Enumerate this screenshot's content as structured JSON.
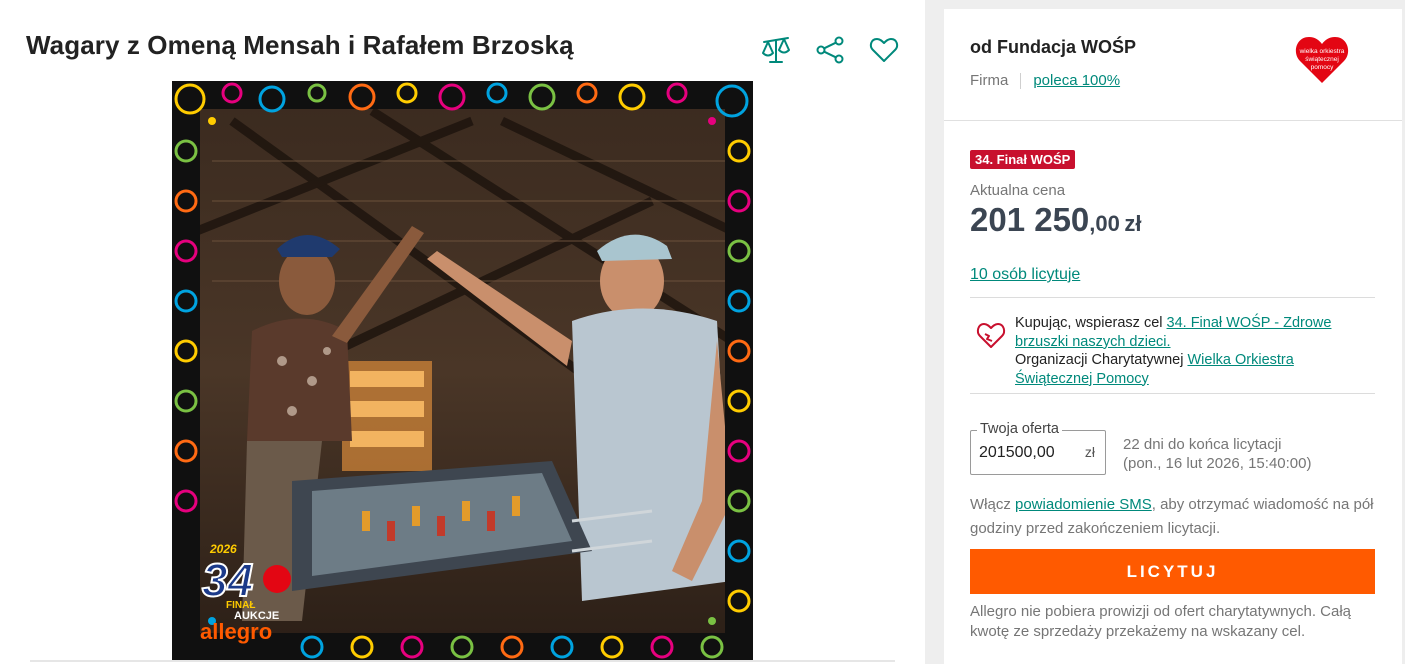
{
  "offer": {
    "title": "Wagary z Omeną Mensah i Rafałem Brzoską",
    "actions": [
      {
        "icon": "compare-scales-icon"
      },
      {
        "icon": "share-icon"
      },
      {
        "icon": "heart-icon"
      }
    ],
    "image": {
      "frame_text": "allegro",
      "event_label": "34",
      "year": "2026",
      "finale_label": "FINAŁ",
      "aukcje_label": "AUKCJE"
    }
  },
  "seller": {
    "name": "od Fundacja WOŚP",
    "type": "Firma",
    "recommend": "poleca 100%",
    "logo_text": [
      "wielka orkiestra",
      "świątecznej",
      "pomocy"
    ]
  },
  "pricing": {
    "badge": "34. Finał WOŚP",
    "label": "Aktualna cena",
    "amount_main": "201 250",
    "amount_decimal": ",00",
    "currency": "zł",
    "bidders": "10 osób licytuje"
  },
  "charity": {
    "text_1": "Kupując, wspierasz cel ",
    "goal_link": "34. Finał WOŚP - Zdrowe brzuszki naszych dzieci.",
    "text_2": "Organizacji Charytatywnej ",
    "org_link": "Wielka Orkiestra Świątecznej Pomocy"
  },
  "bid": {
    "legend": "Twoja oferta",
    "value": "201500,00",
    "currency": "zł",
    "days_left": "22 dni do końca licytacji",
    "end_date": "(pon., 16 lut 2026, 15:40:00)"
  },
  "sms": {
    "text_1": "Włącz ",
    "link": "powiadomienie SMS",
    "text_2": ", aby otrzymać wiadomość na pół godziny przed zakończeniem licytacji."
  },
  "button_label": "LICYTUJ",
  "note": "Allegro nie pobiera prowizji od ofert charytatywnych. Całą kwotę ze sprzedaży przekażemy na wskazany cel.",
  "colors": {
    "accent_teal": "#00897b",
    "button_orange": "#ff5a00",
    "badge_red": "#c8102e",
    "price_text": "#3b4552"
  }
}
